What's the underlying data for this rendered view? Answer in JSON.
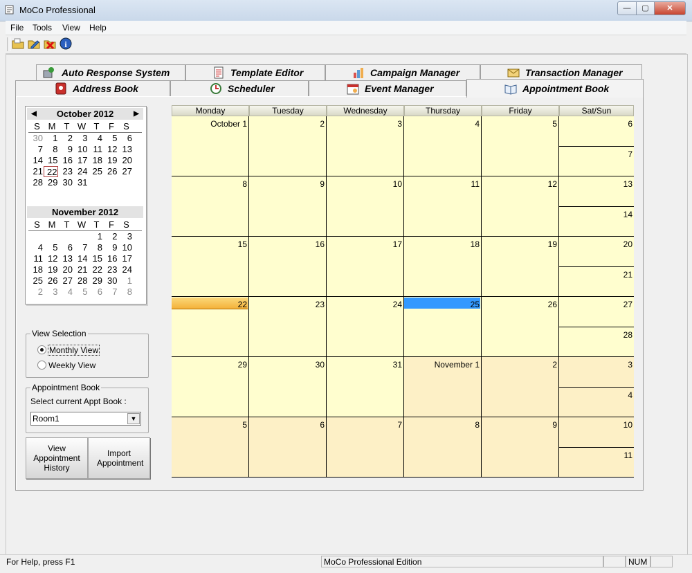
{
  "window": {
    "title": "MoCo Professional",
    "min_glyph": "—",
    "max_glyph": "▢",
    "close_glyph": "✕"
  },
  "menu": [
    "File",
    "Tools",
    "View",
    "Help"
  ],
  "toolbar": {
    "icons": [
      "open-folder-icon",
      "edit-icon",
      "delete-icon",
      "info-icon"
    ],
    "info_glyph": "i"
  },
  "tabs": {
    "row_back": [
      "Auto Response System",
      "Template Editor",
      "Campaign Manager",
      "Transaction Manager"
    ],
    "row_front": [
      "Address Book",
      "Scheduler",
      "Event Manager",
      "Appointment Book"
    ],
    "active": "Appointment Book"
  },
  "mini_calendar": {
    "prev_glyph": "◀",
    "next_glyph": "▶",
    "months": [
      {
        "title": "October 2012",
        "dow": [
          "S",
          "M",
          "T",
          "W",
          "T",
          "F",
          "S"
        ],
        "weeks": [
          [
            "30",
            "1",
            "2",
            "3",
            "4",
            "5",
            "6"
          ],
          [
            "7",
            "8",
            "9",
            "10",
            "11",
            "12",
            "13"
          ],
          [
            "14",
            "15",
            "16",
            "17",
            "18",
            "19",
            "20"
          ],
          [
            "21",
            "22",
            "23",
            "24",
            "25",
            "26",
            "27"
          ],
          [
            "28",
            "29",
            "30",
            "31",
            "",
            "",
            ""
          ]
        ],
        "leading_other": 1,
        "trailing_other": 0
      },
      {
        "title": "November 2012",
        "dow": [
          "S",
          "M",
          "T",
          "W",
          "T",
          "F",
          "S"
        ],
        "weeks": [
          [
            "",
            "",
            "",
            "",
            "1",
            "2",
            "3"
          ],
          [
            "4",
            "5",
            "6",
            "7",
            "8",
            "9",
            "10"
          ],
          [
            "11",
            "12",
            "13",
            "14",
            "15",
            "16",
            "17"
          ],
          [
            "18",
            "19",
            "20",
            "21",
            "22",
            "23",
            "24"
          ],
          [
            "25",
            "26",
            "27",
            "28",
            "29",
            "30",
            "1"
          ],
          [
            "2",
            "3",
            "4",
            "5",
            "6",
            "7",
            "8"
          ]
        ],
        "leading_other": 0,
        "trailing_other": 8
      }
    ],
    "today": "22"
  },
  "view_selection": {
    "title": "View Selection",
    "options": [
      "Monthly View",
      "Weekly View"
    ],
    "selected": "Monthly View"
  },
  "appointment_book": {
    "title": "Appointment Book",
    "label": "Select current Appt Book :",
    "value": "Room1",
    "arrow_glyph": "▼"
  },
  "buttons": {
    "history": "View Appointment History",
    "import": "Import Appointment"
  },
  "calendar": {
    "headers": [
      "Monday",
      "Tuesday",
      "Wednesday",
      "Thursday",
      "Friday",
      "Sat/Sun"
    ],
    "weeks": [
      {
        "days": [
          "October 1",
          "2",
          "3",
          "4",
          "5"
        ],
        "sat": "6",
        "sun": "7"
      },
      {
        "days": [
          "8",
          "9",
          "10",
          "11",
          "12"
        ],
        "sat": "13",
        "sun": "14"
      },
      {
        "days": [
          "15",
          "16",
          "17",
          "18",
          "19"
        ],
        "sat": "20",
        "sun": "21"
      },
      {
        "days": [
          "22",
          "23",
          "24",
          "25",
          "26"
        ],
        "sat": "27",
        "sun": "28"
      },
      {
        "days": [
          "29",
          "30",
          "31",
          "November 1",
          "2"
        ],
        "sat": "3",
        "sun": "4"
      },
      {
        "days": [
          "5",
          "6",
          "7",
          "8",
          "9"
        ],
        "sat": "10",
        "sun": "11"
      }
    ],
    "today": "22",
    "selected": "25",
    "colors": {
      "current_month": "#fffecf",
      "other_month": "#fdf0c6",
      "selected": "#3399ff",
      "today": "#f4b23a"
    }
  },
  "status": {
    "help": "For Help, press F1",
    "edition": "MoCo Professional Edition",
    "num": "NUM"
  }
}
